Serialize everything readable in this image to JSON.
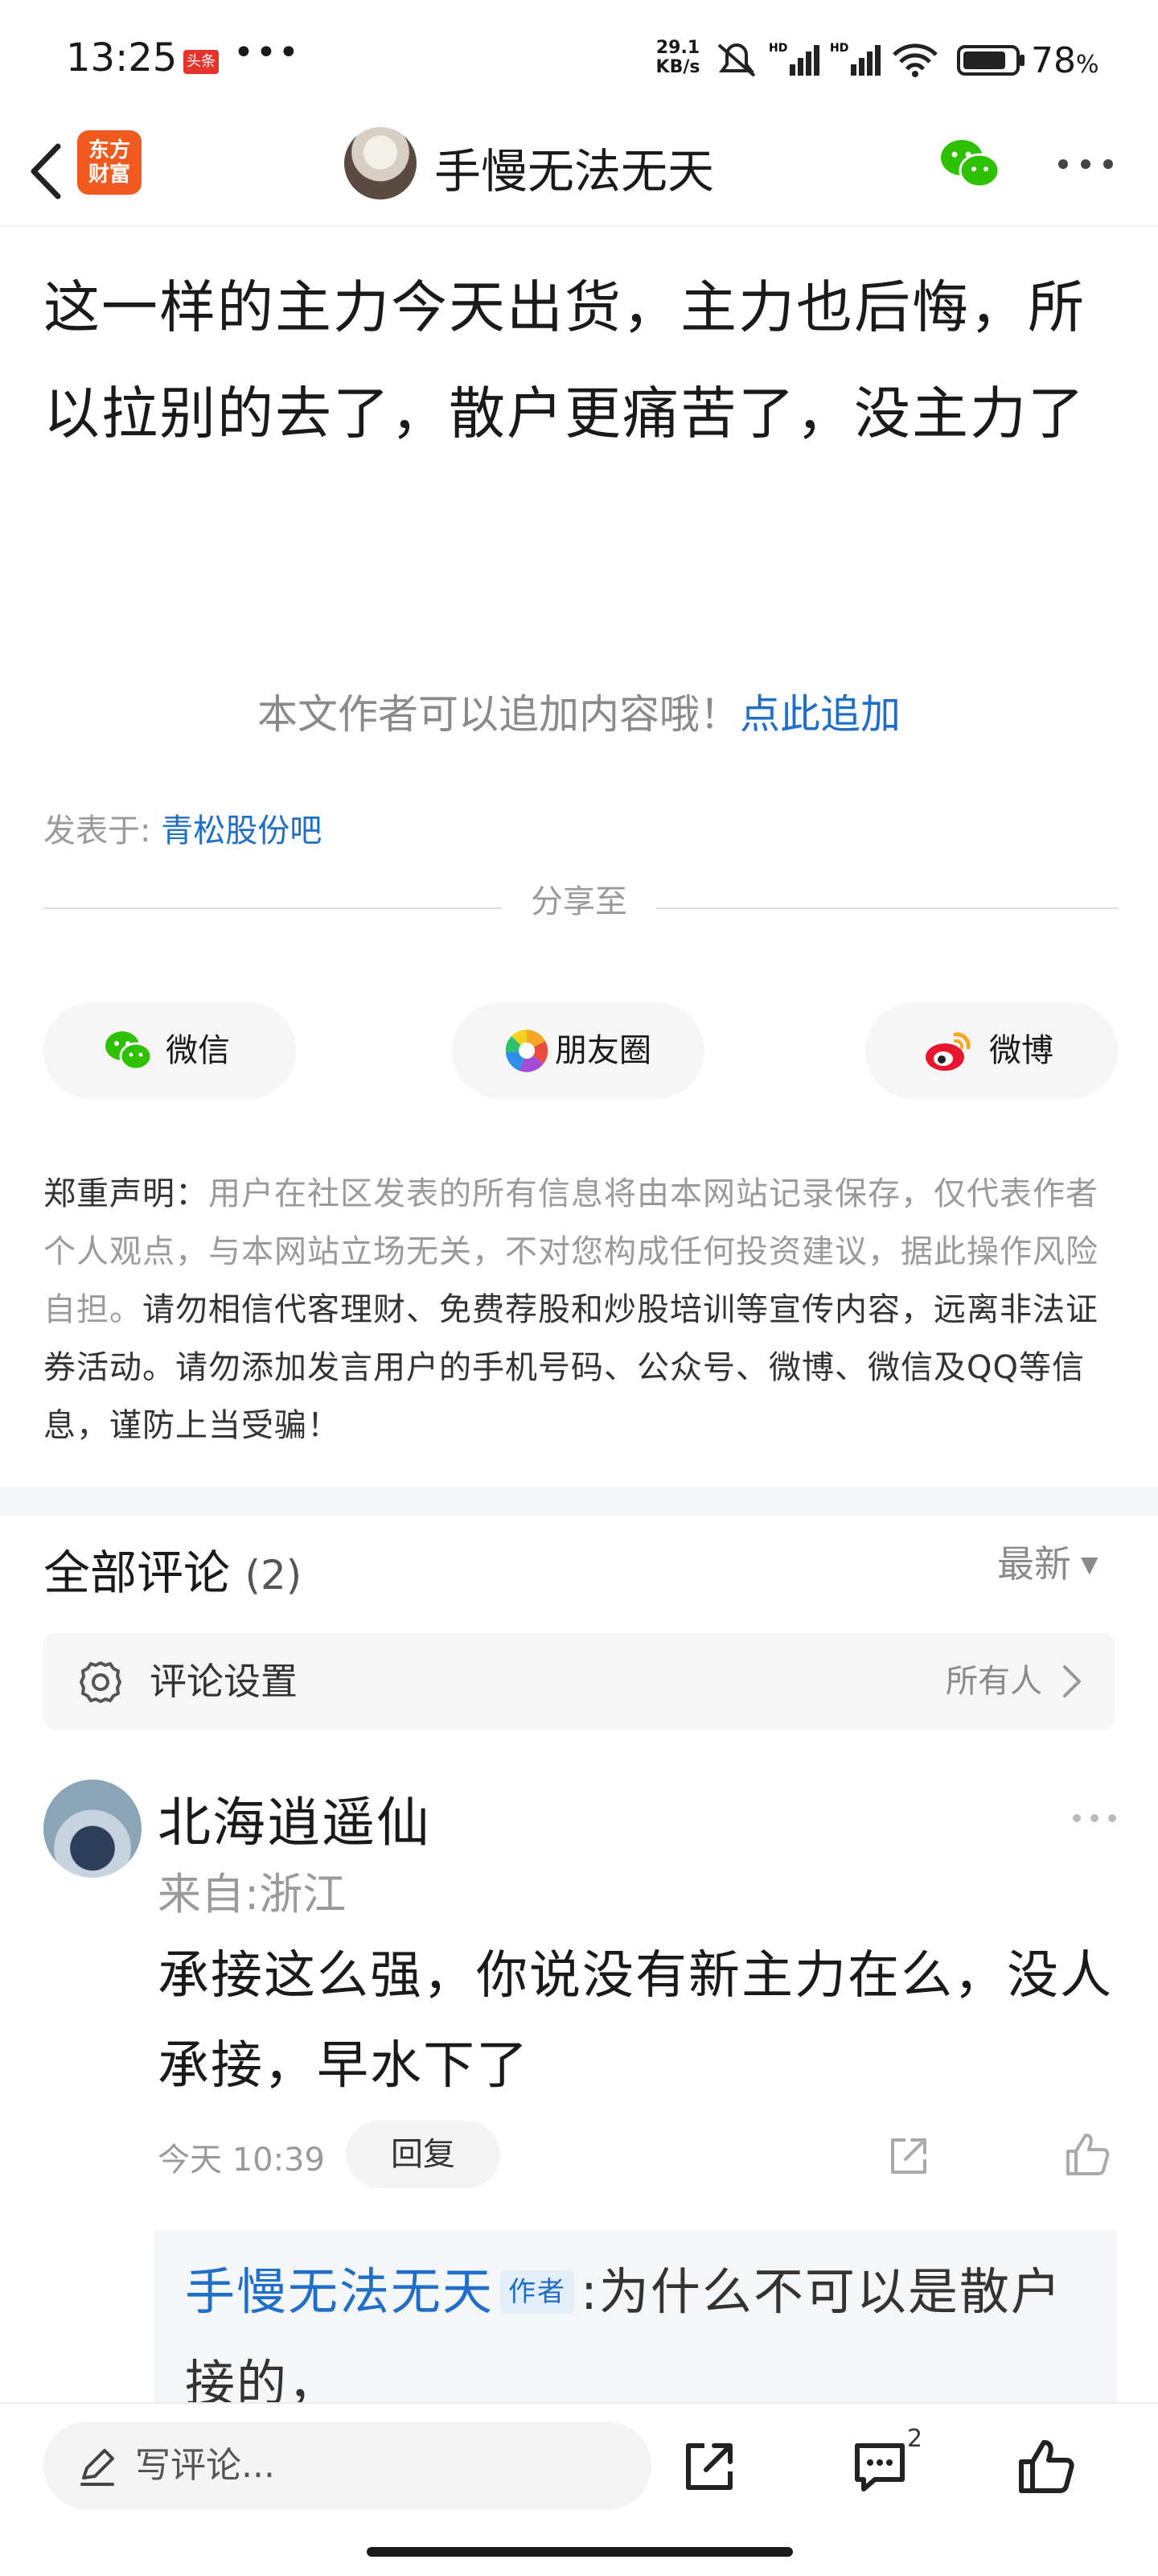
{
  "status_bar": {
    "time": "13:25",
    "badge": "头条",
    "dots": "•••",
    "net_speed": "29.1\nKB/s",
    "battery": "78",
    "battery_unit": "%"
  },
  "nav": {
    "logo_text": "东方\n财富",
    "title": "手慢无法无天"
  },
  "article": {
    "body": "这一样的主力今天出货，主力也后悔，所以拉别的去了，散户更痛苦了，没主力了",
    "append_hint": "本文作者可以追加内容哦！",
    "append_link": "点此追加",
    "posted_label": "发表于:",
    "posted_bar": "青松股份吧"
  },
  "share": {
    "label": "分享至",
    "wechat": "微信",
    "moments": "朋友圈",
    "weibo": "微博"
  },
  "disclaimer": {
    "lead": "郑重声明：",
    "normal": "用户在社区发表的所有信息将由本网站记录保存，仅代表作者个人观点，与本网站立场无关，不对您构成任何投资建议，据此操作风险自担。",
    "strong": "请勿相信代客理财、免费荐股和炒股培训等宣传内容，远离非法证券活动。请勿添加发言用户的手机号码、公众号、微博、微信及QQ等信息，谨防上当受骗！"
  },
  "comments": {
    "title": "全部评论",
    "count": "(2)",
    "sort": "最新",
    "settings_label": "评论设置",
    "settings_value": "所有人",
    "items": [
      {
        "user": "北海逍遥仙",
        "location": "来自:浙江",
        "text": "承接这么强，你说没有新主力在么，没人承接，早水下了",
        "time": "今天 10:39",
        "reply_label": "回复",
        "reply": {
          "user": "手慢无法无天",
          "tag": "作者",
          "text": ":为什么不可以是散户接的，"
        }
      }
    ]
  },
  "bottom_bar": {
    "write_placeholder": "写评论...",
    "comment_badge": "2"
  },
  "colors": {
    "link": "#1f6fc8",
    "brand_orange": "#f05a1e",
    "wechat_green": "#2dc100"
  }
}
